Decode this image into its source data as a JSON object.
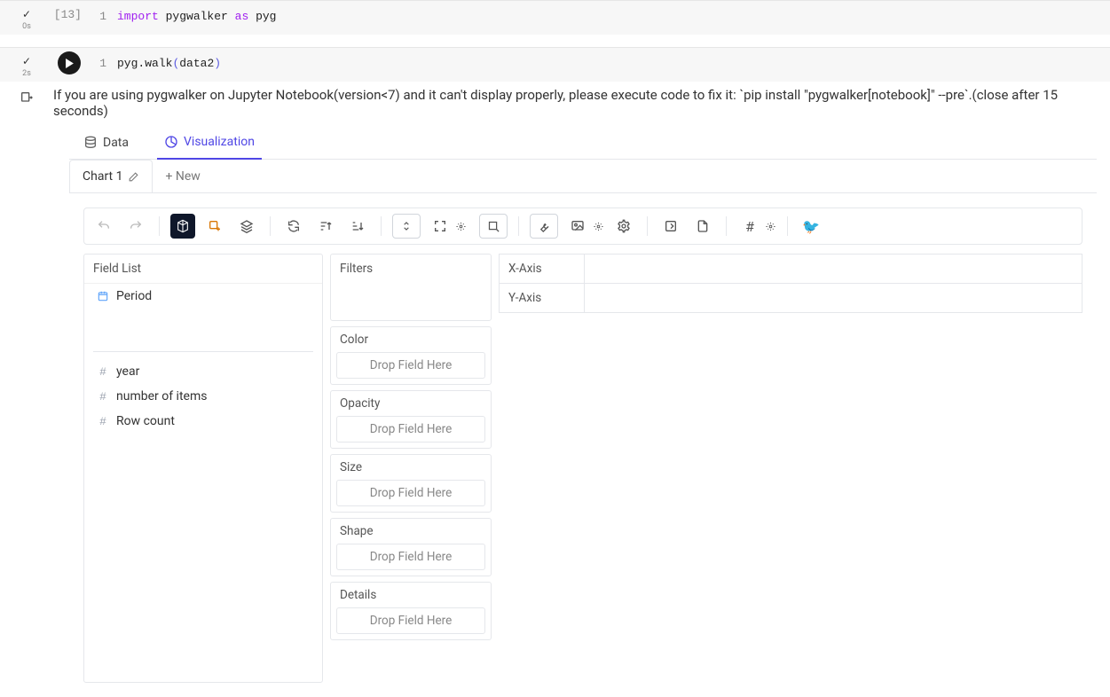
{
  "cells": {
    "first": {
      "counter": "[13]",
      "status_time": "0s",
      "line_no": "1",
      "kw_import": "import",
      "kw_as": "as",
      "mod": "pygwalker",
      "alias": "pyg"
    },
    "second": {
      "status_time": "2s",
      "line_no": "1",
      "obj": "pyg",
      "method": "walk",
      "arg": "data2"
    }
  },
  "warning": "If you are using pygwalker on Jupyter Notebook(version<7) and it can't display properly, please execute code to fix it: `pip install \"pygwalker[notebook]\" --pre`.(close after 15 seconds)",
  "topTabs": {
    "data": "Data",
    "viz": "Visualization"
  },
  "chartTabs": {
    "chart1": "Chart 1",
    "new": "+ New"
  },
  "fieldList": {
    "title": "Field List",
    "dim": {
      "period": "Period"
    },
    "meas": {
      "year": "year",
      "items": "number of items",
      "rowcount": "Row count"
    }
  },
  "shelves": {
    "filters": "Filters",
    "color": "Color",
    "opacity": "Opacity",
    "size": "Size",
    "shape": "Shape",
    "details": "Details",
    "drop": "Drop Field Here"
  },
  "axes": {
    "x": "X-Axis",
    "y": "Y-Axis"
  }
}
